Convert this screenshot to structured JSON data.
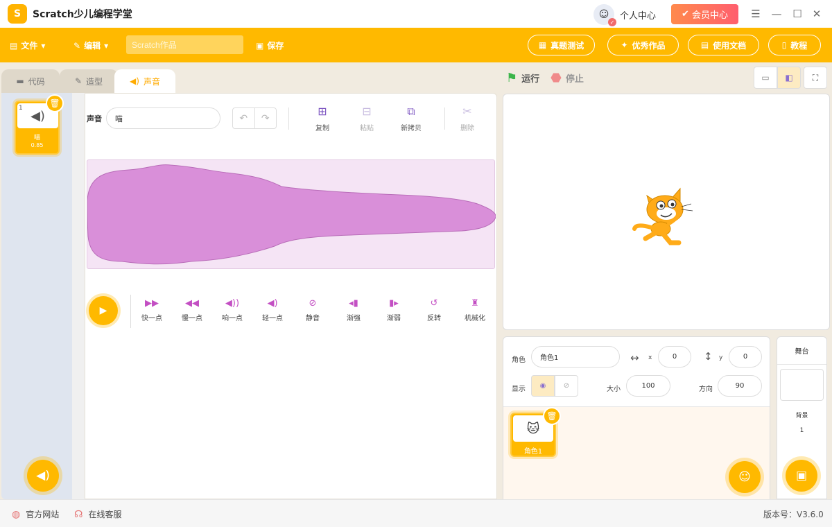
{
  "app": {
    "title": "Scratch少儿编程学堂",
    "logo_letter": "S",
    "user_center": "个人中心",
    "vip": "会员中心",
    "version": "版本号：V3.6.0"
  },
  "toolbar": {
    "file": "文件",
    "edit": "编辑",
    "project_placeholder": "Scratch作品",
    "save": "保存",
    "exam": "真题测试",
    "featured": "优秀作品",
    "docs": "使用文档",
    "tutorial": "教程"
  },
  "tabs": [
    {
      "label": "代码"
    },
    {
      "label": "造型"
    },
    {
      "label": "声音"
    }
  ],
  "sound_list": [
    {
      "index": "1",
      "name": "喵",
      "duration": "0.85"
    }
  ],
  "sound_editor": {
    "label": "声音",
    "name": "喵",
    "tools": [
      {
        "label": "复制"
      },
      {
        "label": "粘贴"
      },
      {
        "label": "新拷贝"
      },
      {
        "label": "删除"
      }
    ],
    "effects": [
      {
        "label": "快一点"
      },
      {
        "label": "慢一点"
      },
      {
        "label": "响一点"
      },
      {
        "label": "轻一点"
      },
      {
        "label": "静音"
      },
      {
        "label": "渐强"
      },
      {
        "label": "渐弱"
      },
      {
        "label": "反转"
      },
      {
        "label": "机械化"
      }
    ]
  },
  "stage_controls": {
    "run": "运行",
    "stop": "停止"
  },
  "sprite_info": {
    "sprite_label": "角色",
    "sprite_name": "角色1",
    "x_label": "x",
    "x": "0",
    "y_label": "y",
    "y": "0",
    "show_label": "显示",
    "size_label": "大小",
    "size": "100",
    "direction_label": "方向",
    "direction": "90"
  },
  "sprites": [
    {
      "name": "角色1"
    }
  ],
  "stage_panel": {
    "title": "舞台",
    "backdrop_label": "背景",
    "backdrop_count": "1"
  },
  "footer": {
    "website": "官方网站",
    "support": "在线客服"
  },
  "colors": {
    "accent": "#ffb900",
    "wave": "#d98fd9",
    "vip": "#ff6a5e"
  }
}
